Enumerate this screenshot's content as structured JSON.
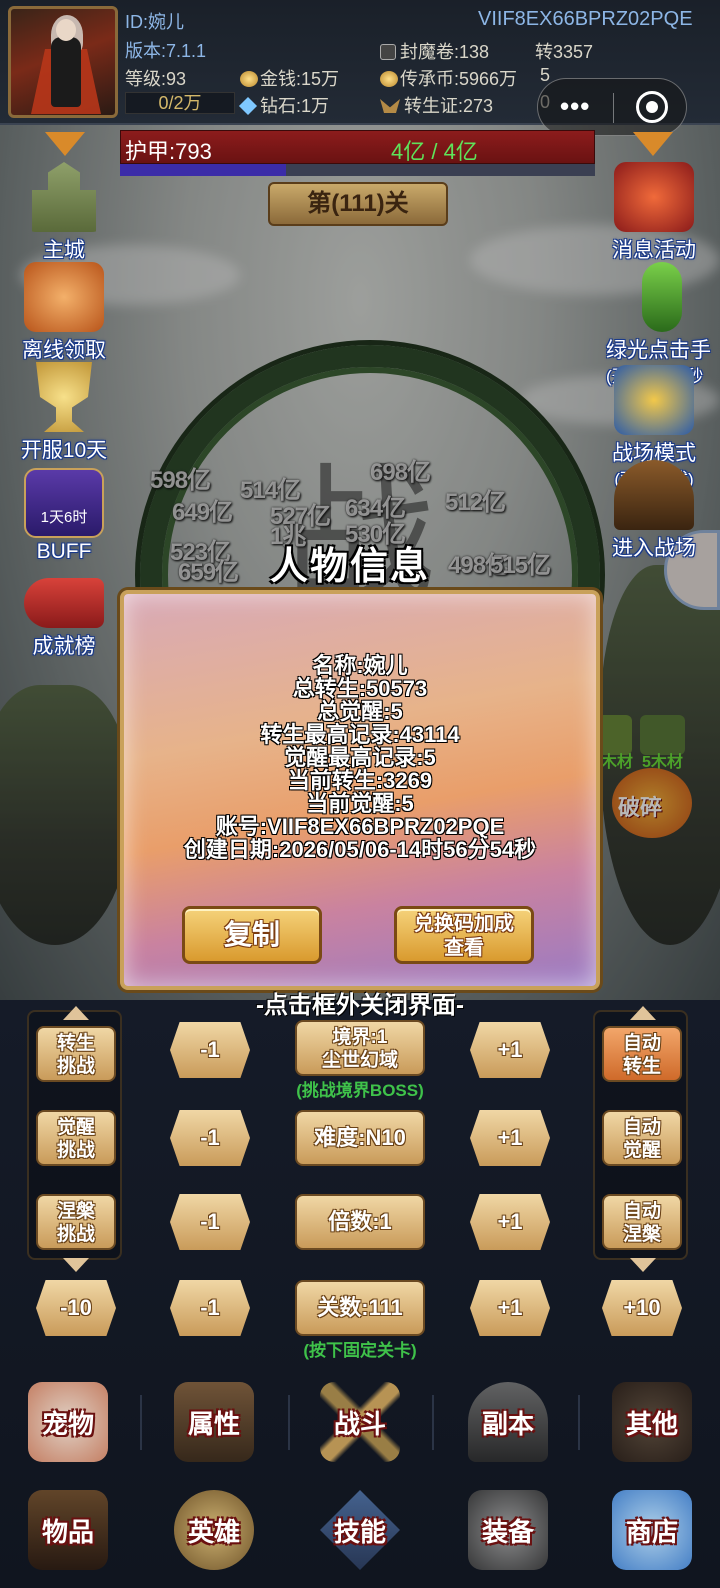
{
  "player": {
    "id": "ID:婉儿",
    "version": "版本:7.1.1",
    "level": "等级:93",
    "exp": "0/2万",
    "account_code": "VIIF8EX66BPRZ02PQE",
    "gold": "金钱:15万",
    "diamond": "钻石:1万",
    "seal_scroll": "封魔卷:138",
    "inherit_coin": "传承币:5966万",
    "rebirth_cert": "转生证:273",
    "transfer": "转3357",
    "extra_a": "5",
    "extra_b": "0"
  },
  "armor": {
    "label": "护甲:793",
    "value": "4亿 / 4亿",
    "shield_fraction": 0.35
  },
  "stage": {
    "title": "第(111)关"
  },
  "left_menu": [
    {
      "label": "主城",
      "icon": "castle-icon"
    },
    {
      "label": "离线领取",
      "icon": "offline-reward-icon"
    },
    {
      "label": "开服10天",
      "icon": "trophy-icon"
    },
    {
      "label": "BUFF",
      "icon": "buff-icon",
      "badge": "1天6时"
    },
    {
      "label": "成就榜",
      "icon": "scroll-icon"
    }
  ],
  "right_menu": [
    {
      "label": "消息活动",
      "icon": "message-event-icon"
    },
    {
      "label": "绿光点击手",
      "sub": "(开启10次/秒",
      "icon": "green-clicker-icon"
    },
    {
      "label": "战场模式",
      "sub": "(观察模式)",
      "icon": "battlefield-icon"
    },
    {
      "label": "进入战场",
      "icon": "gate-icon"
    }
  ],
  "floating_damage": [
    "598亿",
    "514亿",
    "698亿",
    "649亿",
    "527亿",
    "634亿",
    "512亿",
    "523亿",
    "530亿",
    "659亿",
    "498亿",
    "515亿",
    "1兆"
  ],
  "background_text": {
    "battle_char": "战",
    "mid_labels": [
      "5木材",
      "5木材",
      "破碎"
    ]
  },
  "modal": {
    "title": "人物信息",
    "rows": [
      "名称:婉儿",
      "总转生:50573",
      "总觉醒:5",
      "转生最高记录:43114",
      "觉醒最高记录:5",
      "当前转生:3269",
      "当前觉醒:5",
      "账号:VIIF8EX66BPRZ02PQE",
      "创建日期:2026/05/06-14时56分54秒"
    ],
    "copy_button": "复制",
    "exchange_button_line1": "兑换码加成",
    "exchange_button_line2": "查看",
    "close_hint": "-点击框外关闭界面-"
  },
  "controls": {
    "rebirth_challenge": [
      "转生",
      "挑战"
    ],
    "awaken_challenge": [
      "觉醒",
      "挑战"
    ],
    "nirvana_challenge": [
      "涅槃",
      "挑战"
    ],
    "auto_rebirth": [
      "自动",
      "转生"
    ],
    "auto_awaken": [
      "自动",
      "觉醒"
    ],
    "auto_nirvana": [
      "自动",
      "涅槃"
    ],
    "realm_line1": "境界:1",
    "realm_line2": "尘世幻域",
    "realm_note": "(挑战境界BOSS)",
    "difficulty": "难度:N10",
    "multiplier": "倍数:1",
    "stage_count": "关数:111",
    "stage_note": "(按下固定关卡)",
    "minus1": "-1",
    "plus1": "+1",
    "minus10": "-10",
    "plus10": "+10"
  },
  "bottom_nav": [
    "宠物",
    "属性",
    "战斗",
    "副本",
    "其他",
    "物品",
    "英雄",
    "技能",
    "装备",
    "商店"
  ],
  "colors": {
    "armor_bar": "#8c1c1c",
    "armor_value": "#5fe35a",
    "stat_blue": "#8db6e6",
    "button_gold": "#d99a2e",
    "note_green": "#3fc24a"
  }
}
